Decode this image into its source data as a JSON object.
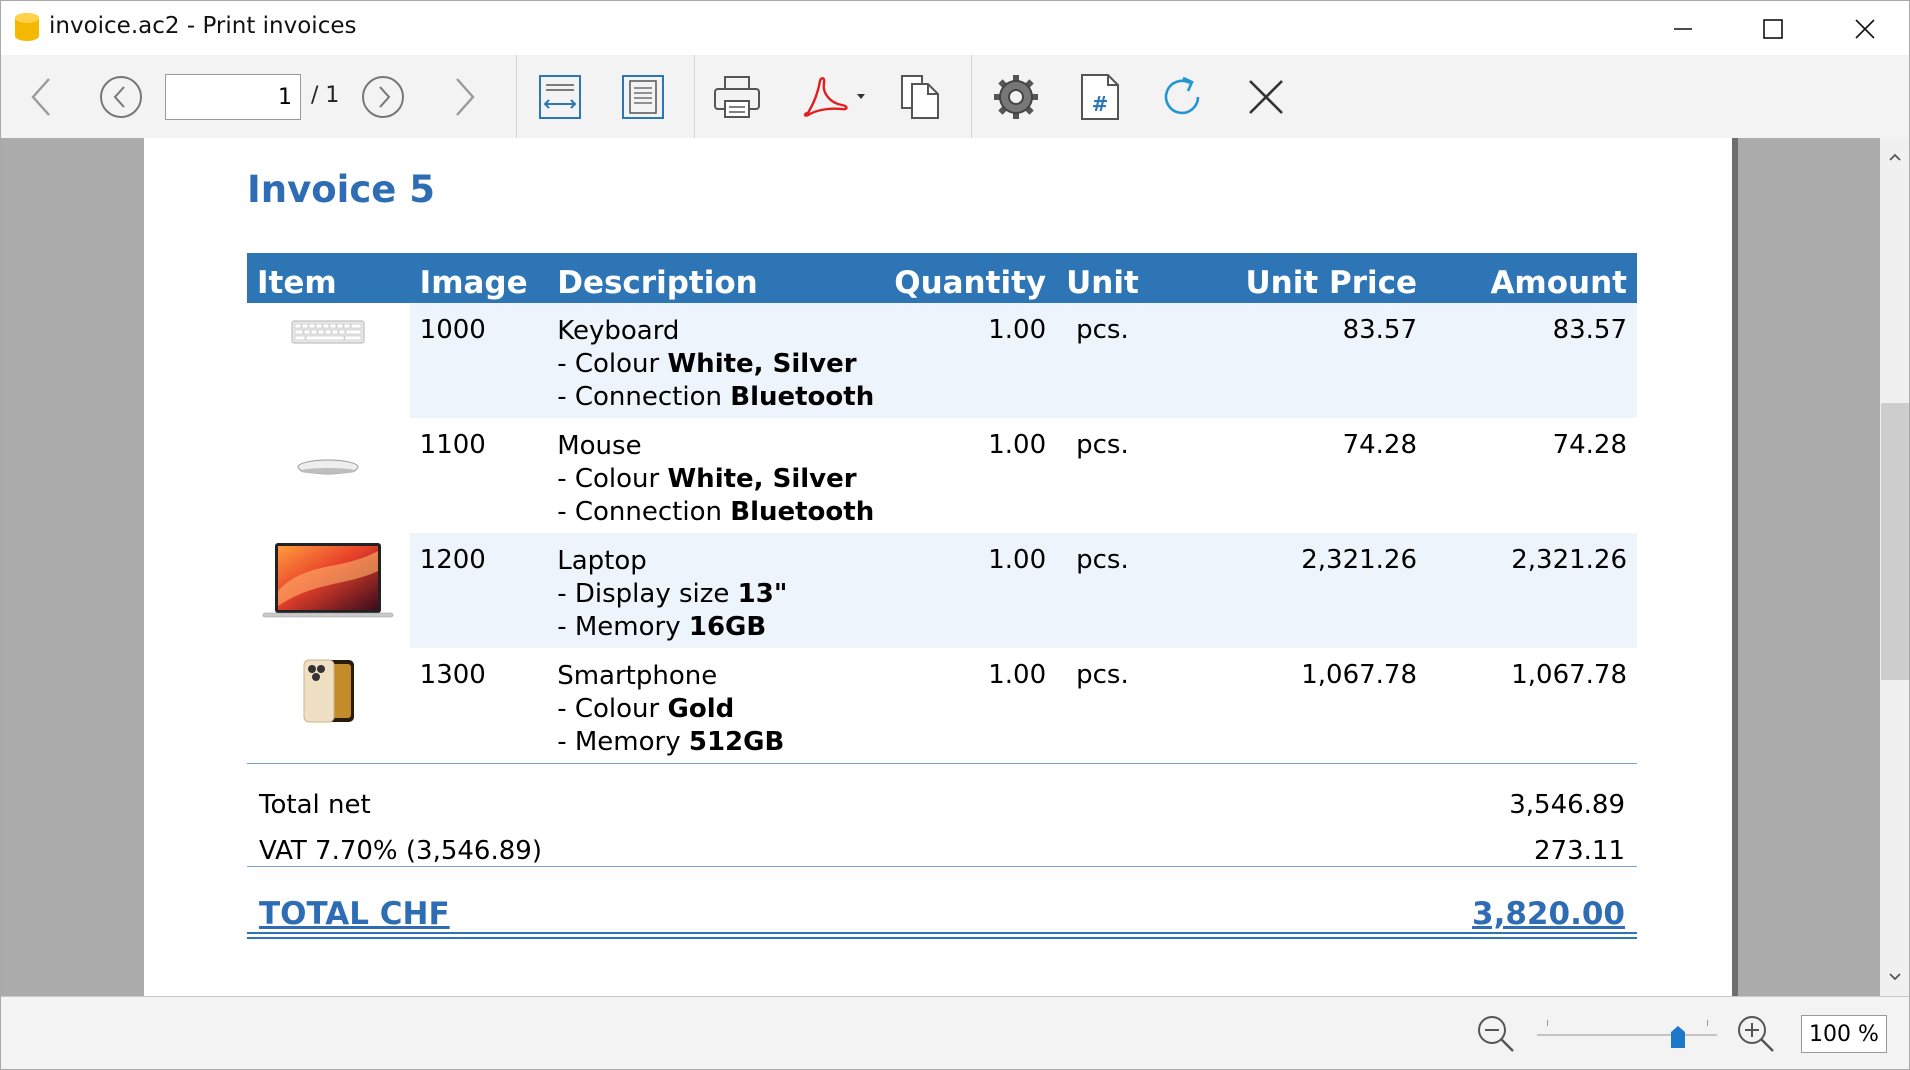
{
  "window": {
    "title": "invoice.ac2 - Print invoices"
  },
  "toolbar": {
    "page_current": "1",
    "page_total": "/ 1",
    "buttons": [
      "back-arrow-icon",
      "previous-page-icon",
      "next-page-icon",
      "forward-arrow-icon",
      "fit-width-icon",
      "fit-page-icon",
      "printer-icon",
      "pdf-icon",
      "copy-icon",
      "settings-gear-icon",
      "page-number-icon",
      "refresh-icon",
      "close-x-icon"
    ]
  },
  "invoice": {
    "title": "Invoice 5",
    "headers": [
      "Item",
      "Image",
      "Description",
      "Quantity",
      "Unit",
      "Unit Price",
      "Amount"
    ],
    "rows": [
      {
        "item": "1000",
        "image": "keyboard-image",
        "name": "Keyboard",
        "attrs": [
          {
            "label": "- Colour",
            "value": "White, Silver"
          },
          {
            "label": "- Connection",
            "value": "Bluetooth"
          }
        ],
        "quantity": "1.00",
        "unit": "pcs.",
        "unit_price": "83.57",
        "amount": "83.57"
      },
      {
        "item": "1100",
        "image": "mouse-image",
        "name": "Mouse",
        "attrs": [
          {
            "label": "- Colour",
            "value": "White, Silver"
          },
          {
            "label": "- Connection",
            "value": "Bluetooth"
          }
        ],
        "quantity": "1.00",
        "unit": "pcs.",
        "unit_price": "74.28",
        "amount": "74.28"
      },
      {
        "item": "1200",
        "image": "laptop-image",
        "name": "Laptop",
        "attrs": [
          {
            "label": "- Display size",
            "value": "13\""
          },
          {
            "label": "- Memory",
            "value": "16GB"
          }
        ],
        "quantity": "1.00",
        "unit": "pcs.",
        "unit_price": "2,321.26",
        "amount": "2,321.26"
      },
      {
        "item": "1300",
        "image": "smartphone-image",
        "name": "Smartphone",
        "attrs": [
          {
            "label": "- Colour",
            "value": "Gold"
          },
          {
            "label": "- Memory",
            "value": "512GB"
          }
        ],
        "quantity": "1.00",
        "unit": "pcs.",
        "unit_price": "1,067.78",
        "amount": "1,067.78"
      }
    ],
    "total_net_label": "Total net",
    "total_net_value": "3,546.89",
    "vat_label": "VAT 7.70% (3,546.89)",
    "vat_value": "273.11",
    "total_label": "TOTAL CHF",
    "total_value": "3,820.00"
  },
  "statusbar": {
    "zoom_value": "100 %",
    "zoom_level_percent": 100
  },
  "colors": {
    "accent": "#2e75b6",
    "title_blue": "#2e6db4",
    "row_shade": "#edf4fb"
  }
}
